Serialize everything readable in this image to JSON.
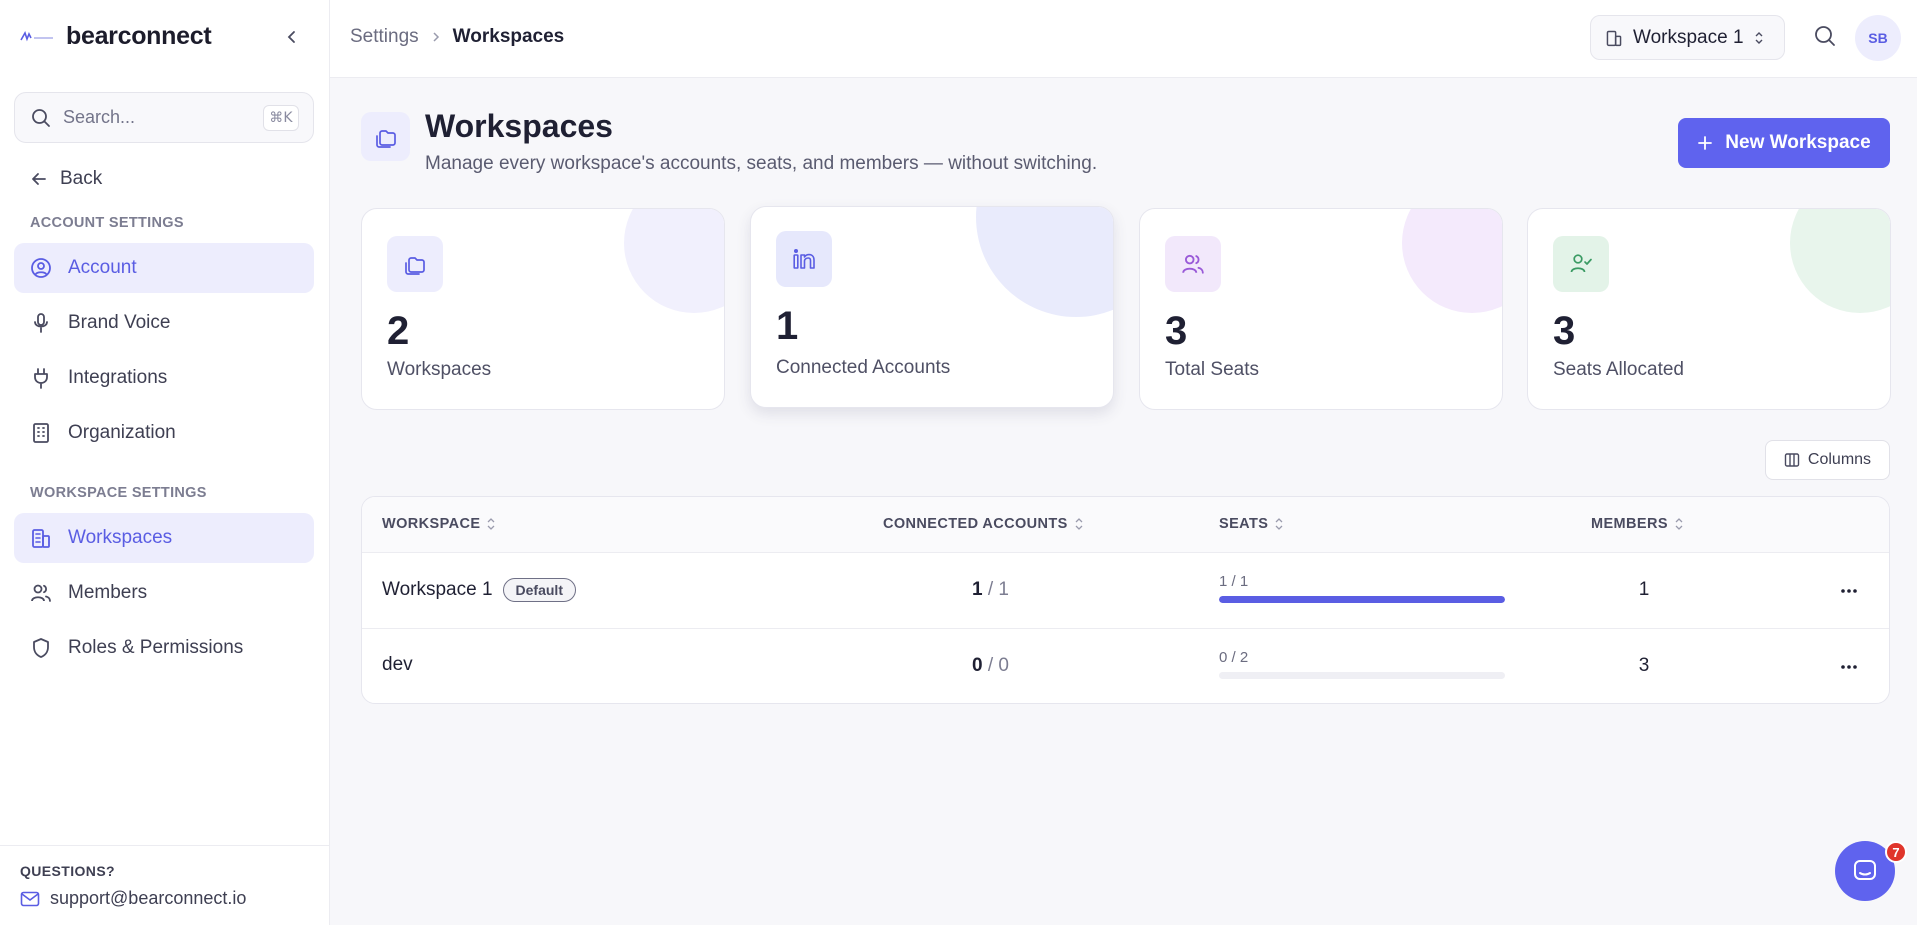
{
  "sidebar": {
    "brand_name": "bearconnect",
    "search": {
      "placeholder": "Search...",
      "shortcut": "⌘K"
    },
    "back_label": "Back",
    "account_section_label": "ACCOUNT SETTINGS",
    "account_items": [
      {
        "label": "Account",
        "icon": "user-circle-icon",
        "active": true
      },
      {
        "label": "Brand Voice",
        "icon": "microphone-icon",
        "active": false
      },
      {
        "label": "Integrations",
        "icon": "plug-icon",
        "active": false
      },
      {
        "label": "Organization",
        "icon": "building-icon",
        "active": false
      }
    ],
    "workspace_section_label": "WORKSPACE SETTINGS",
    "workspace_items": [
      {
        "label": "Workspaces",
        "icon": "buildings-icon",
        "active": true
      },
      {
        "label": "Members",
        "icon": "users-icon",
        "active": false
      },
      {
        "label": "Roles & Permissions",
        "icon": "shield-icon",
        "active": false
      }
    ],
    "footer": {
      "questions_label": "QUESTIONS?",
      "support_email": "support@bearconnect.io"
    }
  },
  "header": {
    "breadcrumb": [
      "Settings",
      "Workspaces"
    ],
    "workspace_selector": "Workspace 1",
    "avatar_initials": "SB"
  },
  "main": {
    "title": "Workspaces",
    "subtitle": "Manage every workspace's accounts, seats, and members — without switching.",
    "new_button_label": "New Workspace",
    "stats": [
      {
        "value": "2",
        "label": "Workspaces",
        "icon": "folders-icon",
        "color": "#5a5de3"
      },
      {
        "value": "1",
        "label": "Connected Accounts",
        "icon": "linkedin-icon",
        "color": "#5a5de3"
      },
      {
        "value": "3",
        "label": "Total Seats",
        "icon": "users-icon",
        "color": "#9a5ad8"
      },
      {
        "value": "3",
        "label": "Seats Allocated",
        "icon": "user-check-icon",
        "color": "#3a9a63"
      }
    ],
    "columns_button_label": "Columns",
    "table": {
      "headers": [
        "WORKSPACE",
        "CONNECTED ACCOUNTS",
        "SEATS",
        "MEMBERS"
      ],
      "rows": [
        {
          "name": "Workspace 1",
          "badge": "Default",
          "connected": "1",
          "connected_total": "1",
          "seats_text": "1 / 1",
          "seats_fraction": 1.0,
          "members": "1"
        },
        {
          "name": "dev",
          "badge": "",
          "connected": "0",
          "connected_total": "0",
          "seats_text": "0 / 2",
          "seats_fraction": 0.0,
          "members": "3"
        }
      ]
    }
  },
  "chat": {
    "badge_count": "7"
  },
  "colors": {
    "accent": "#5f63ee",
    "active_bg": "#ededfd",
    "badge_red": "#e0352b"
  }
}
